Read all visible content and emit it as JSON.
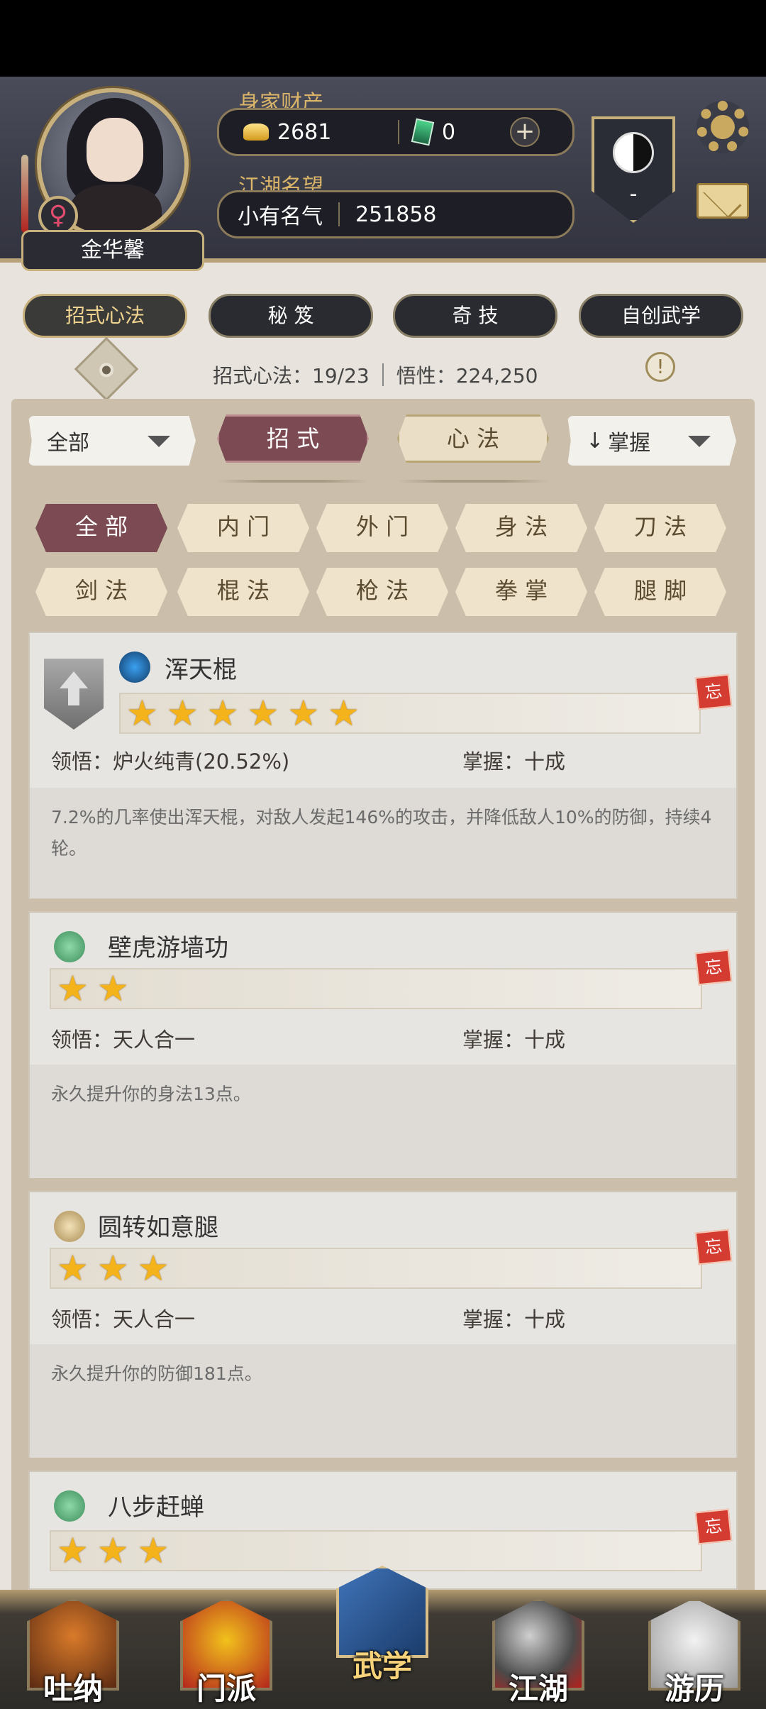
{
  "header": {
    "player_name": "金华馨",
    "gender_symbol": "♀",
    "wealth_label": "身家财产",
    "gold_amount": "2681",
    "jade_amount": "0",
    "plus_symbol": "+",
    "reputation_label": "江湖名望",
    "reputation_title": "小有名气",
    "reputation_value": "251858",
    "badge_value": "-"
  },
  "main_tabs": [
    {
      "label": "招式心法",
      "active": true
    },
    {
      "label": "秘 笈",
      "active": false
    },
    {
      "label": "奇 技",
      "active": false
    },
    {
      "label": "自创武学",
      "active": false
    }
  ],
  "summary": {
    "moves_text": "招式心法：19/23",
    "insight_text": "悟性：224,250",
    "info_symbol": "!"
  },
  "controls": {
    "scope_dropdown": "全部",
    "tab_moves": "招 式",
    "tab_mind": "心 法",
    "sort_dropdown": "掌握",
    "sort_arrow": "↓"
  },
  "filters": [
    {
      "label": "全 部",
      "active": true
    },
    {
      "label": "内 门",
      "active": false
    },
    {
      "label": "外 门",
      "active": false
    },
    {
      "label": "身 法",
      "active": false
    },
    {
      "label": "刀 法",
      "active": false
    },
    {
      "label": "剑 法",
      "active": false
    },
    {
      "label": "棍 法",
      "active": false
    },
    {
      "label": "枪 法",
      "active": false
    },
    {
      "label": "拳 掌",
      "active": false
    },
    {
      "label": "腿 脚",
      "active": false
    }
  ],
  "skills": [
    {
      "name": "浑天棍",
      "stars": 6,
      "comprehension": "领悟：炉火纯青(20.52%)",
      "mastery": "掌握：十成",
      "description": "7.2%的几率使出浑天棍，对敌人发起146%的攻击，并降低敌人10%的防御，持续4轮。",
      "forget": "忘",
      "icon": "staff-icon"
    },
    {
      "name": "壁虎游墙功",
      "stars": 2,
      "comprehension": "领悟：天人合一",
      "mastery": "掌握：十成",
      "description": "永久提升你的身法13点。",
      "forget": "忘",
      "icon": "boot-icon"
    },
    {
      "name": "圆转如意腿",
      "stars": 3,
      "comprehension": "领悟：天人合一",
      "mastery": "掌握：十成",
      "description": "永久提升你的防御181点。",
      "forget": "忘",
      "icon": "horn-icon"
    },
    {
      "name": "八步赶蝉",
      "stars": 3,
      "forget": "忘",
      "icon": "boot-icon"
    }
  ],
  "star_glyph": "★",
  "bottom_nav": [
    {
      "label": "吐纳",
      "active": false
    },
    {
      "label": "门派",
      "active": false
    },
    {
      "label": "武学",
      "active": true
    },
    {
      "label": "江湖",
      "active": false
    },
    {
      "label": "游历",
      "active": false
    }
  ],
  "colors": {
    "accent_gold": "#c8b07c",
    "active_tab": "#7b4a52",
    "star": "#f4b21b"
  }
}
